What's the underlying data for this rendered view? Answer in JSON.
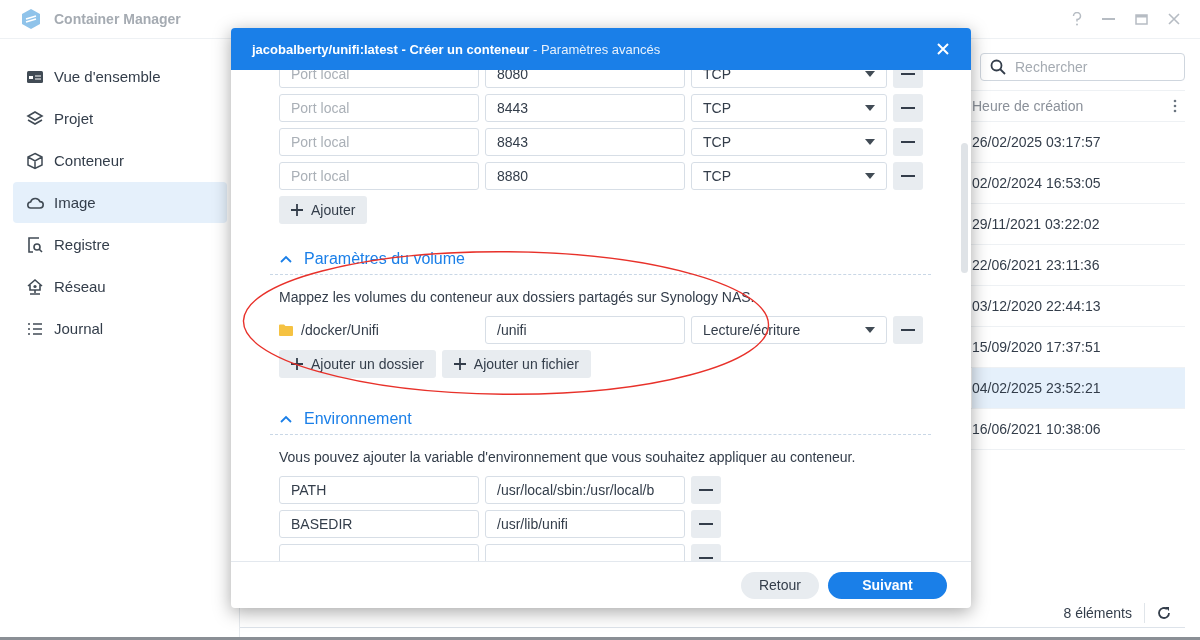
{
  "window": {
    "title": "Container Manager"
  },
  "sidebar": {
    "items": [
      {
        "label": "Vue d'ensemble",
        "selected": false
      },
      {
        "label": "Projet",
        "selected": false
      },
      {
        "label": "Conteneur",
        "selected": false
      },
      {
        "label": "Image",
        "selected": true
      },
      {
        "label": "Registre",
        "selected": false
      },
      {
        "label": "Réseau",
        "selected": false
      },
      {
        "label": "Journal",
        "selected": false
      }
    ]
  },
  "search": {
    "placeholder": "Rechercher"
  },
  "table": {
    "columns": [
      "Heure de création"
    ],
    "rows": [
      {
        "cells": [
          "26/02/2025 03:17:57"
        ],
        "selected": false
      },
      {
        "cells": [
          "02/02/2024 16:53:05"
        ],
        "selected": false
      },
      {
        "cells": [
          "29/11/2021 03:22:02"
        ],
        "selected": false
      },
      {
        "cells": [
          "22/06/2021 23:11:36"
        ],
        "selected": false
      },
      {
        "cells": [
          "03/12/2020 22:44:13"
        ],
        "selected": false
      },
      {
        "cells": [
          "15/09/2020 17:37:51"
        ],
        "selected": false
      },
      {
        "cells": [
          "04/02/2025 23:52:21"
        ],
        "selected": true
      },
      {
        "cells": [
          "16/06/2021 10:38:06"
        ],
        "selected": false
      }
    ]
  },
  "status_bar": {
    "count": "8 éléments"
  },
  "dialog": {
    "title": "**jacobalberty/unifi:latest - Créer un conteneur** - Paramètres avancés",
    "ports": [
      {
        "local_placeholder": "Port local",
        "container_port": "8080",
        "protocol": "TCP"
      },
      {
        "local_placeholder": "Port local",
        "container_port": "8443",
        "protocol": "TCP"
      },
      {
        "local_placeholder": "Port local",
        "container_port": "8843",
        "protocol": "TCP"
      },
      {
        "local_placeholder": "Port local",
        "container_port": "8880",
        "protocol": "TCP"
      }
    ],
    "add_port_button": "Ajouter",
    "volume_section": {
      "title": "Paramètres du volume",
      "expanded": true,
      "description": "Mappez les volumes du conteneur aux dossiers partagés sur Synology NAS.",
      "volumes": [
        {
          "folder": "/docker/Unifi",
          "mount": "/unifi",
          "mode": "Lecture/écriture"
        }
      ],
      "buttons": [
        "Ajouter un dossier",
        "Ajouter un fichier"
      ]
    },
    "environment_section": {
      "title": "Environnement",
      "expanded": true,
      "description": "Vous pouvez ajouter la variable d'environnement que vous souhaitez appliquer au conteneur.",
      "variables": [
        {
          "name": "PATH",
          "value": "/usr/local/sbin:/usr/local/b"
        },
        {
          "name": "BASEDIR",
          "value": "/usr/lib/unifi"
        }
      ]
    },
    "buttons": [
      {
        "label": "Retour",
        "kind": "secondary"
      },
      {
        "label": "Suivant",
        "kind": "primary"
      }
    ]
  }
}
